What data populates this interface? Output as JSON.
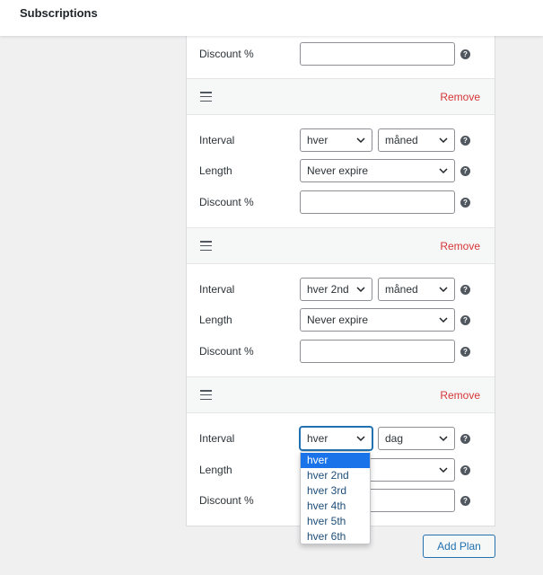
{
  "header": {
    "title": "Subscriptions"
  },
  "labels": {
    "interval": "Interval",
    "length": "Length",
    "discount": "Discount %",
    "remove": "Remove",
    "help": "?"
  },
  "plans": [
    {
      "interval_every": "hver",
      "interval_unit": "måned",
      "length": "Never expire",
      "discount": ""
    },
    {
      "interval_every": "hver 2nd",
      "interval_unit": "måned",
      "length": "Never expire",
      "discount": ""
    },
    {
      "interval_every": "hver",
      "interval_unit": "dag",
      "length": "",
      "discount": ""
    }
  ],
  "dropdown": {
    "options": [
      "hver",
      "hver 2nd",
      "hver 3rd",
      "hver 4th",
      "hver 5th",
      "hver 6th"
    ],
    "selected": "hver"
  },
  "add_plan_label": "Add Plan",
  "colors": {
    "accent": "#2271b1",
    "remove": "#d63638",
    "dropdown_highlight": "#1a73e8"
  }
}
